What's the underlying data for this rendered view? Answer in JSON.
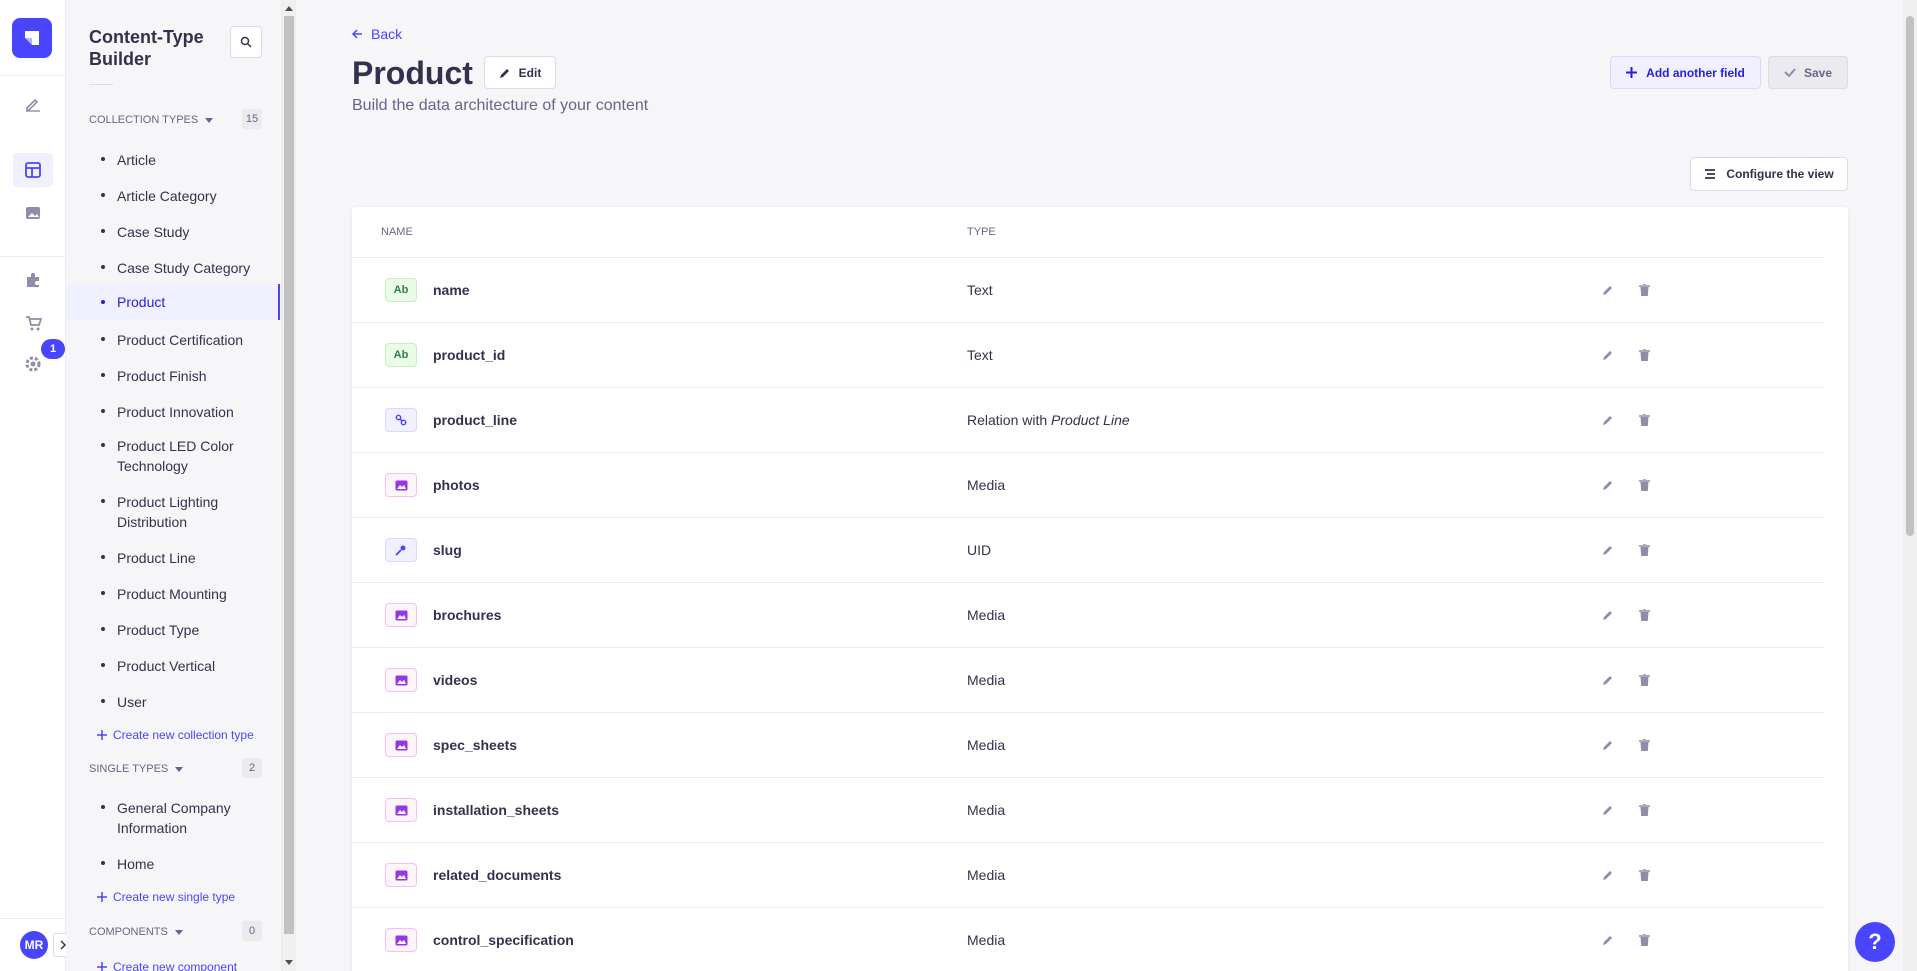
{
  "rail": {
    "badge": "1",
    "avatar": "MR",
    "icons": [
      "strapi-logo-icon",
      "pencil-content-icon",
      "layout-builder-icon",
      "media-library-icon",
      "puzzle-plugins-icon",
      "cart-marketplace-icon",
      "gear-settings-icon"
    ]
  },
  "subnav": {
    "title": "Content-Type Builder",
    "collection_types": {
      "label": "Collection Types",
      "count": "15",
      "items": [
        {
          "label": "Article"
        },
        {
          "label": "Article Category"
        },
        {
          "label": "Case Study"
        },
        {
          "label": "Case Study Category"
        },
        {
          "label": "Product"
        },
        {
          "label": "Product Certification"
        },
        {
          "label": "Product Finish"
        },
        {
          "label": "Product Innovation"
        },
        {
          "label": "Product LED Color Technology"
        },
        {
          "label": "Product Lighting Distribution"
        },
        {
          "label": "Product Line"
        },
        {
          "label": "Product Mounting"
        },
        {
          "label": "Product Type"
        },
        {
          "label": "Product Vertical"
        },
        {
          "label": "User"
        }
      ],
      "create_label": "Create new collection type"
    },
    "single_types": {
      "label": "Single Types",
      "count": "2",
      "items": [
        {
          "label": "General Company Information"
        },
        {
          "label": "Home"
        }
      ],
      "create_label": "Create new single type"
    },
    "components": {
      "label": "Components",
      "count": "0",
      "create_label": "Create new component"
    }
  },
  "main": {
    "back_label": "Back",
    "title": "Product",
    "edit_label": "Edit",
    "subtitle": "Build the data architecture of your content",
    "add_field_label": "Add another field",
    "save_label": "Save",
    "configure_label": "Configure the view",
    "columns": [
      "Name",
      "Type"
    ],
    "fields": [
      {
        "icon": "Ab",
        "kind": "text",
        "name": "name",
        "type": "Text",
        "relation": ""
      },
      {
        "icon": "Ab",
        "kind": "text",
        "name": "product_id",
        "type": "Text",
        "relation": ""
      },
      {
        "icon": "relation-icon",
        "kind": "relation",
        "name": "product_line",
        "type": "Relation with",
        "relation": "Product Line"
      },
      {
        "icon": "media-icon",
        "kind": "media",
        "name": "photos",
        "type": "Media",
        "relation": ""
      },
      {
        "icon": "uid-key-icon",
        "kind": "uid",
        "name": "slug",
        "type": "UID",
        "relation": ""
      },
      {
        "icon": "media-icon",
        "kind": "media",
        "name": "brochures",
        "type": "Media",
        "relation": ""
      },
      {
        "icon": "media-icon",
        "kind": "media",
        "name": "videos",
        "type": "Media",
        "relation": ""
      },
      {
        "icon": "media-icon",
        "kind": "media",
        "name": "spec_sheets",
        "type": "Media",
        "relation": ""
      },
      {
        "icon": "media-icon",
        "kind": "media",
        "name": "installation_sheets",
        "type": "Media",
        "relation": ""
      },
      {
        "icon": "media-icon",
        "kind": "media",
        "name": "related_documents",
        "type": "Media",
        "relation": ""
      },
      {
        "icon": "media-icon",
        "kind": "media",
        "name": "control_specification",
        "type": "Media",
        "relation": ""
      }
    ]
  },
  "help_label": "?",
  "colors": {
    "accent": "#4945ff",
    "background": "#f6f6f9"
  }
}
